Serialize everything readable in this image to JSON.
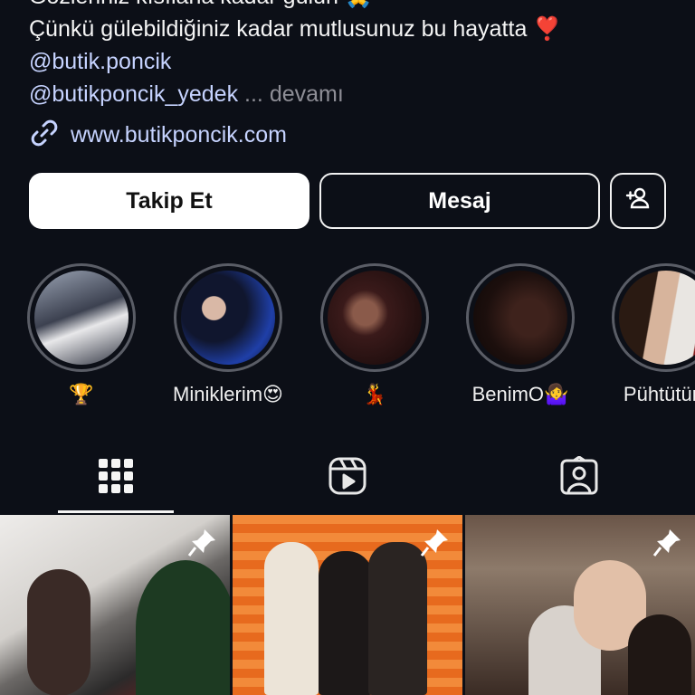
{
  "bio": {
    "line_cut": "Gözleriniz kısılana kadar gülün 🙏",
    "line2": "Çünkü gülebildiğiniz kadar mutlusunuz bu hayatta ❣️",
    "mention1": "@butik.poncik",
    "mention2": "@butikponcik_yedek",
    "ellipsis": "...",
    "more": "devamı",
    "website": "www.butikponcik.com"
  },
  "actions": {
    "follow_label": "Takip Et",
    "message_label": "Mesaj",
    "add_user_icon": "person-add-icon"
  },
  "highlights": [
    {
      "label": "🏆",
      "color": "#6d7380"
    },
    {
      "label": "Miniklerim😍",
      "color": "#1f3fa8"
    },
    {
      "label": "💃",
      "color": "#3a1a1a"
    },
    {
      "label": "BenimO🤷‍♀️",
      "color": "#2a1614"
    },
    {
      "label": "Pühtütüm",
      "color": "#c9c4bf"
    }
  ],
  "tabs": [
    {
      "name": "grid",
      "icon": "grid-icon",
      "active": true
    },
    {
      "name": "reels",
      "icon": "reels-icon",
      "active": false
    },
    {
      "name": "tagged",
      "icon": "tagged-icon",
      "active": false
    }
  ],
  "posts": [
    {
      "pinned": true,
      "colors": [
        "#d9d6d2",
        "#2b2a2a",
        "#8c1b1b"
      ]
    },
    {
      "pinned": true,
      "colors": [
        "#f07a2a",
        "#ede6dc",
        "#1a1818"
      ]
    },
    {
      "pinned": true,
      "colors": [
        "#6a5548",
        "#d8d2cc",
        "#2a1e1a"
      ]
    }
  ]
}
